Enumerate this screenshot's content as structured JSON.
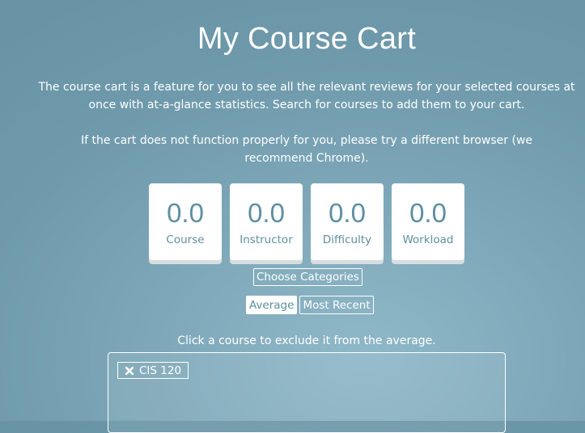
{
  "header": {
    "title": "My Course Cart"
  },
  "intro": {
    "description": "The course cart is a feature for you to see all the relevant reviews for your selected courses at once with at-a-glance statistics. Search for courses to add them to your cart.",
    "browser_note": "If the cart does not function properly for you, please try a different browser (we recommend Chrome)."
  },
  "stats": [
    {
      "value": "0.0",
      "label": "Course"
    },
    {
      "value": "0.0",
      "label": "Instructor"
    },
    {
      "value": "0.0",
      "label": "Difficulty"
    },
    {
      "value": "0.0",
      "label": "Workload"
    }
  ],
  "controls": {
    "choose_categories_label": "Choose Categories",
    "average_label": "Average",
    "most_recent_label": "Most Recent",
    "selected": "Average"
  },
  "cart": {
    "hint": "Click a course to exclude it from the average.",
    "courses": [
      {
        "code": "CIS 120",
        "icon": "close-icon"
      }
    ]
  },
  "colors": {
    "background": "#6f9aab",
    "accent": "#5e8fa1",
    "card": "#ffffff"
  }
}
